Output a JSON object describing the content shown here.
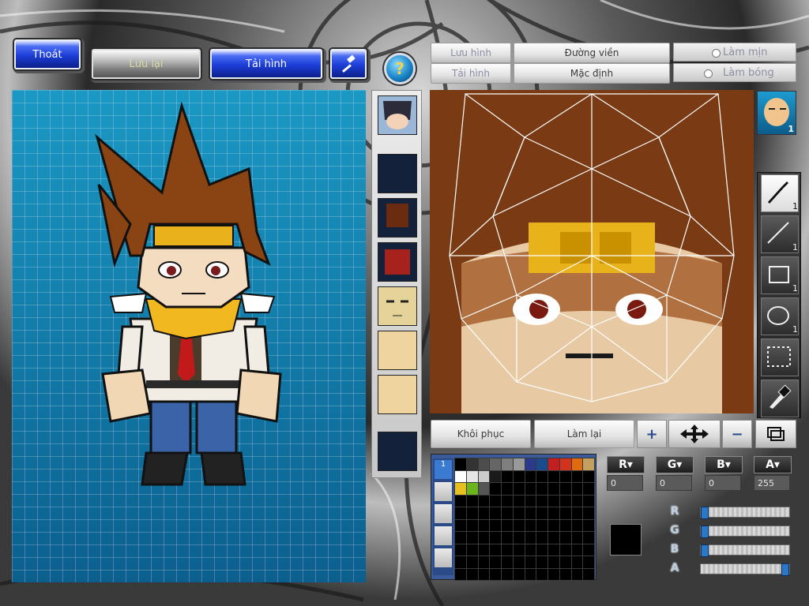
{
  "top_bar": {
    "exit_label": "Thoát",
    "save_label": "Lưu lại",
    "load_label": "Tải hình"
  },
  "texture_toolbar": {
    "save_label": "Lưu hình",
    "load_label": "Tải hình",
    "outline_label": "Đường viền",
    "default_label": "Mặc định",
    "smooth_label": "Làm mịn",
    "shine_label": "Làm bóng"
  },
  "preview": {
    "count": "1"
  },
  "tools": [
    {
      "name": "brush",
      "count": "1",
      "active": true
    },
    {
      "name": "line",
      "count": "1",
      "active": false
    },
    {
      "name": "rectangle",
      "count": "1",
      "active": false
    },
    {
      "name": "ellipse",
      "count": "1",
      "active": false
    },
    {
      "name": "selection",
      "count": "",
      "active": false
    },
    {
      "name": "eyedropper",
      "count": "",
      "active": false
    }
  ],
  "edit_buttons": {
    "restore_label": "Khôi phục",
    "redo_label": "Làm lại"
  },
  "palette": {
    "colors": [
      "#000000",
      "#333333",
      "#4d4d4d",
      "#666666",
      "#7f7f7f",
      "#999999",
      "#2b3a8a",
      "#1a4b8d",
      "#c22020",
      "#d3321c",
      "#e06a10",
      "#c4a060",
      "#ffffff",
      "#e6e6e6",
      "#cccccc",
      "#1a1a1a",
      "#000000",
      "#000000",
      "#000000",
      "#000000",
      "#000000",
      "#000000",
      "#000000",
      "#000000",
      "#e6c020",
      "#6ab41c",
      "#555555"
    ],
    "tab_marker": "1"
  },
  "channels": {
    "r": {
      "label": "R",
      "value": "0"
    },
    "g": {
      "label": "G",
      "value": "0"
    },
    "b": {
      "label": "B",
      "value": "0"
    },
    "a": {
      "label": "A",
      "value": "255"
    }
  },
  "sliders": {
    "r": {
      "label": "R",
      "level": 0
    },
    "g": {
      "label": "G",
      "level": 0
    },
    "b": {
      "label": "B",
      "level": 0
    },
    "a": {
      "label": "A",
      "level": 1
    }
  },
  "current_color": "#000000"
}
